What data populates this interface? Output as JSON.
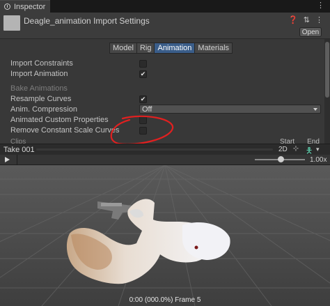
{
  "tab": {
    "label": "Inspector"
  },
  "header": {
    "title": "Deagle_animation Import Settings",
    "open_label": "Open"
  },
  "tabs": [
    "Model",
    "Rig",
    "Animation",
    "Materials"
  ],
  "active_tab": "Animation",
  "properties": [
    {
      "label": "Import Constraints",
      "checked": false
    },
    {
      "label": "Import Animation",
      "checked": true
    },
    {
      "label": "Bake Animations",
      "disabled": true
    },
    {
      "label": "Resample Curves",
      "checked": true
    },
    {
      "label": "Anim. Compression",
      "value": "Off"
    },
    {
      "label": "Animated Custom Properties",
      "checked": false
    },
    {
      "label": "Remove Constant Scale Curves",
      "checked": false
    }
  ],
  "clips": {
    "label": "Clips",
    "start": "Start",
    "end": "End"
  },
  "preview": {
    "take_label": "Take 001",
    "mode_2d": "2D",
    "speed": "1.00x",
    "frame_label": "0:00 (000.0%) Frame 5"
  },
  "colors": {
    "accent_tab": "#3a5d89",
    "annotation": "#e02020",
    "avatar": "#5dd3b0"
  },
  "icons": [
    "info-icon",
    "layout-icon",
    "menu-icon",
    "play-icon",
    "pivot-icon",
    "avatar-icon"
  ]
}
